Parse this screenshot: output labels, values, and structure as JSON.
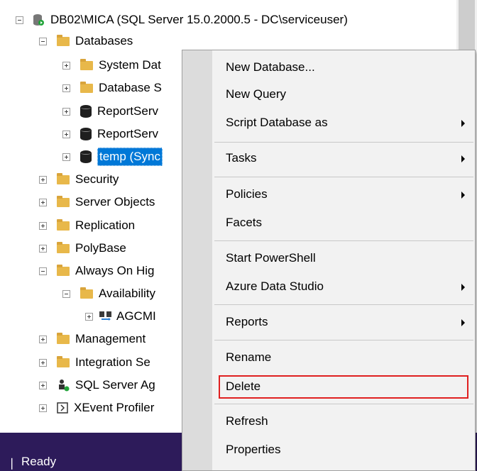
{
  "tree": {
    "server": "DB02\\MICA (SQL Server 15.0.2000.5 - DC\\serviceuser)",
    "items": [
      {
        "label": "Databases",
        "expander": "minus",
        "icon": "folder-icon"
      },
      {
        "label": "System Dat",
        "expander": "plus",
        "icon": "folder-icon"
      },
      {
        "label": "Database S",
        "expander": "plus",
        "icon": "folder-icon"
      },
      {
        "label": "ReportServ",
        "expander": "plus",
        "icon": "database-icon"
      },
      {
        "label": "ReportServ",
        "expander": "plus",
        "icon": "database-icon"
      },
      {
        "label": "temp (Sync",
        "expander": "plus",
        "icon": "database-icon",
        "selected": true
      },
      {
        "label": "Security",
        "expander": "plus",
        "icon": "folder-icon"
      },
      {
        "label": "Server Objects",
        "expander": "plus",
        "icon": "folder-icon"
      },
      {
        "label": "Replication",
        "expander": "plus",
        "icon": "folder-icon"
      },
      {
        "label": "PolyBase",
        "expander": "plus",
        "icon": "folder-icon"
      },
      {
        "label": "Always On Hig",
        "expander": "minus",
        "icon": "folder-icon"
      },
      {
        "label": "Availability",
        "expander": "minus",
        "icon": "folder-icon"
      },
      {
        "label": "AGCMI",
        "expander": "plus",
        "icon": "availability-group-icon"
      },
      {
        "label": "Management",
        "expander": "plus",
        "icon": "folder-icon"
      },
      {
        "label": "Integration Se",
        "expander": "plus",
        "icon": "folder-icon"
      },
      {
        "label": "SQL Server Ag",
        "expander": "plus",
        "icon": "sql-agent-icon"
      },
      {
        "label": "XEvent Profiler",
        "expander": "plus",
        "icon": "xevent-icon"
      }
    ]
  },
  "status": {
    "text": "Ready"
  },
  "context_menu": {
    "items": [
      {
        "label": "New Database..."
      },
      {
        "label": "New Query"
      },
      {
        "label": "Script Database as",
        "submenu": true
      },
      {
        "label": "Tasks",
        "submenu": true
      },
      {
        "label": "Policies",
        "submenu": true
      },
      {
        "label": "Facets"
      },
      {
        "label": "Start PowerShell"
      },
      {
        "label": "Azure Data Studio",
        "submenu": true
      },
      {
        "label": "Reports",
        "submenu": true
      },
      {
        "label": "Rename"
      },
      {
        "label": "Delete",
        "highlighted": true
      },
      {
        "label": "Refresh"
      },
      {
        "label": "Properties"
      }
    ]
  },
  "colors": {
    "selection": "#0078d7",
    "status_bar": "#2d1b5a",
    "highlight_box": "#e02020"
  }
}
